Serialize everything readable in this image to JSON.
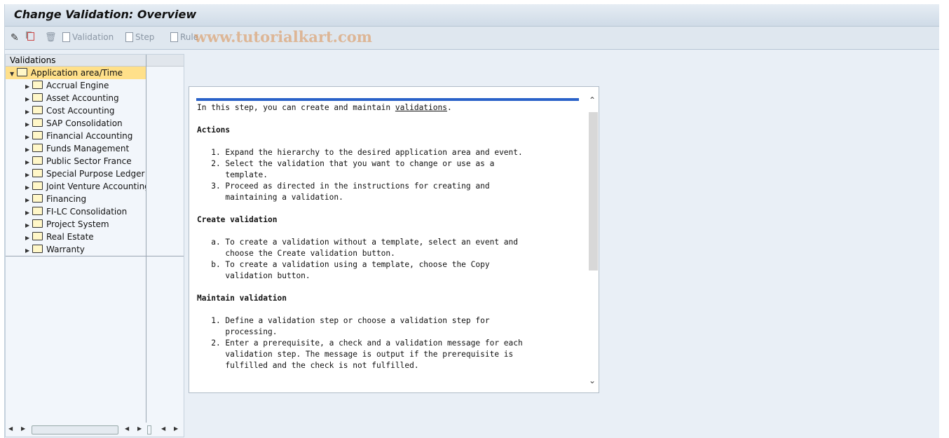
{
  "window": {
    "title": "Change Validation: Overview"
  },
  "toolbar": {
    "items": [
      {
        "icon": "pencil-glasses-icon",
        "label": ""
      },
      {
        "icon": "copy-icon",
        "label": ""
      },
      {
        "icon": "trash-icon",
        "label": ""
      },
      {
        "icon": "document-icon",
        "label": "Validation"
      },
      {
        "icon": "document-icon",
        "label": "Step"
      },
      {
        "icon": "document-icon",
        "label": "Rule"
      }
    ]
  },
  "watermark": "www.tutorialkart.com",
  "tree": {
    "header": "Validations",
    "root": "Application area/Time",
    "items": [
      "Accrual Engine",
      "Asset Accounting",
      "Cost Accounting",
      "SAP Consolidation",
      "Financial Accounting",
      "Funds Management",
      "Public Sector France",
      "Special Purpose Ledger",
      "Joint Venture Accounting",
      "Financing",
      "FI-LC Consolidation",
      "Project System",
      "Real Estate",
      "Warranty"
    ]
  },
  "help": {
    "intro": "In this step, you can create and maintain ",
    "intro_link": "validations",
    "intro_end": ".",
    "actions_title": "Actions",
    "actions": "   1. Expand the hierarchy to the desired application area and event.\n   2. Select the validation that you want to change or use as a\n      template.\n   3. Proceed as directed in the instructions for creating and\n      maintaining a validation.",
    "create_title": "Create validation",
    "create": "   a. To create a validation without a template, select an event and\n      choose the Create validation button.\n   b. To create a validation using a template, choose the Copy\n      validation button.",
    "maintain_title": "Maintain validation",
    "maintain": "   1. Define a validation step or choose a validation step for\n      processing.\n   2. Enter a prerequisite, a check and a validation message for each\n      validation step. The message is output if the prerequisite is\n      fulfilled and the check is not fulfilled."
  }
}
